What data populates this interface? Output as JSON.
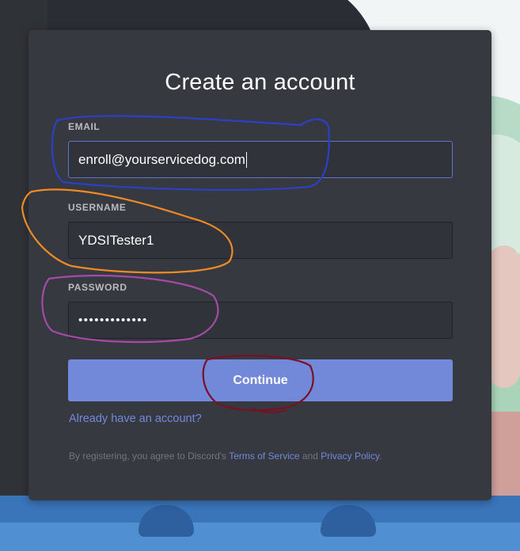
{
  "form": {
    "title": "Create an account",
    "email_label": "EMAIL",
    "email_value": "enroll@yourservicedog.com",
    "username_label": "USERNAME",
    "username_value": "YDSITester1",
    "password_label": "PASSWORD",
    "password_value": "•••••••••••••",
    "continue_label": "Continue",
    "login_link": "Already have an account?",
    "terms_prefix": "By registering, you agree to Discord's",
    "terms_link": "Terms of Service",
    "terms_and": "and",
    "privacy_link": "Privacy Policy",
    "terms_suffix": "."
  },
  "colors": {
    "card_bg": "#36393f",
    "accent": "#7289da",
    "annotation_email": "#2c3fc7",
    "annotation_username": "#f08a24",
    "annotation_password": "#a54aa8",
    "annotation_continue": "#7a1021"
  }
}
